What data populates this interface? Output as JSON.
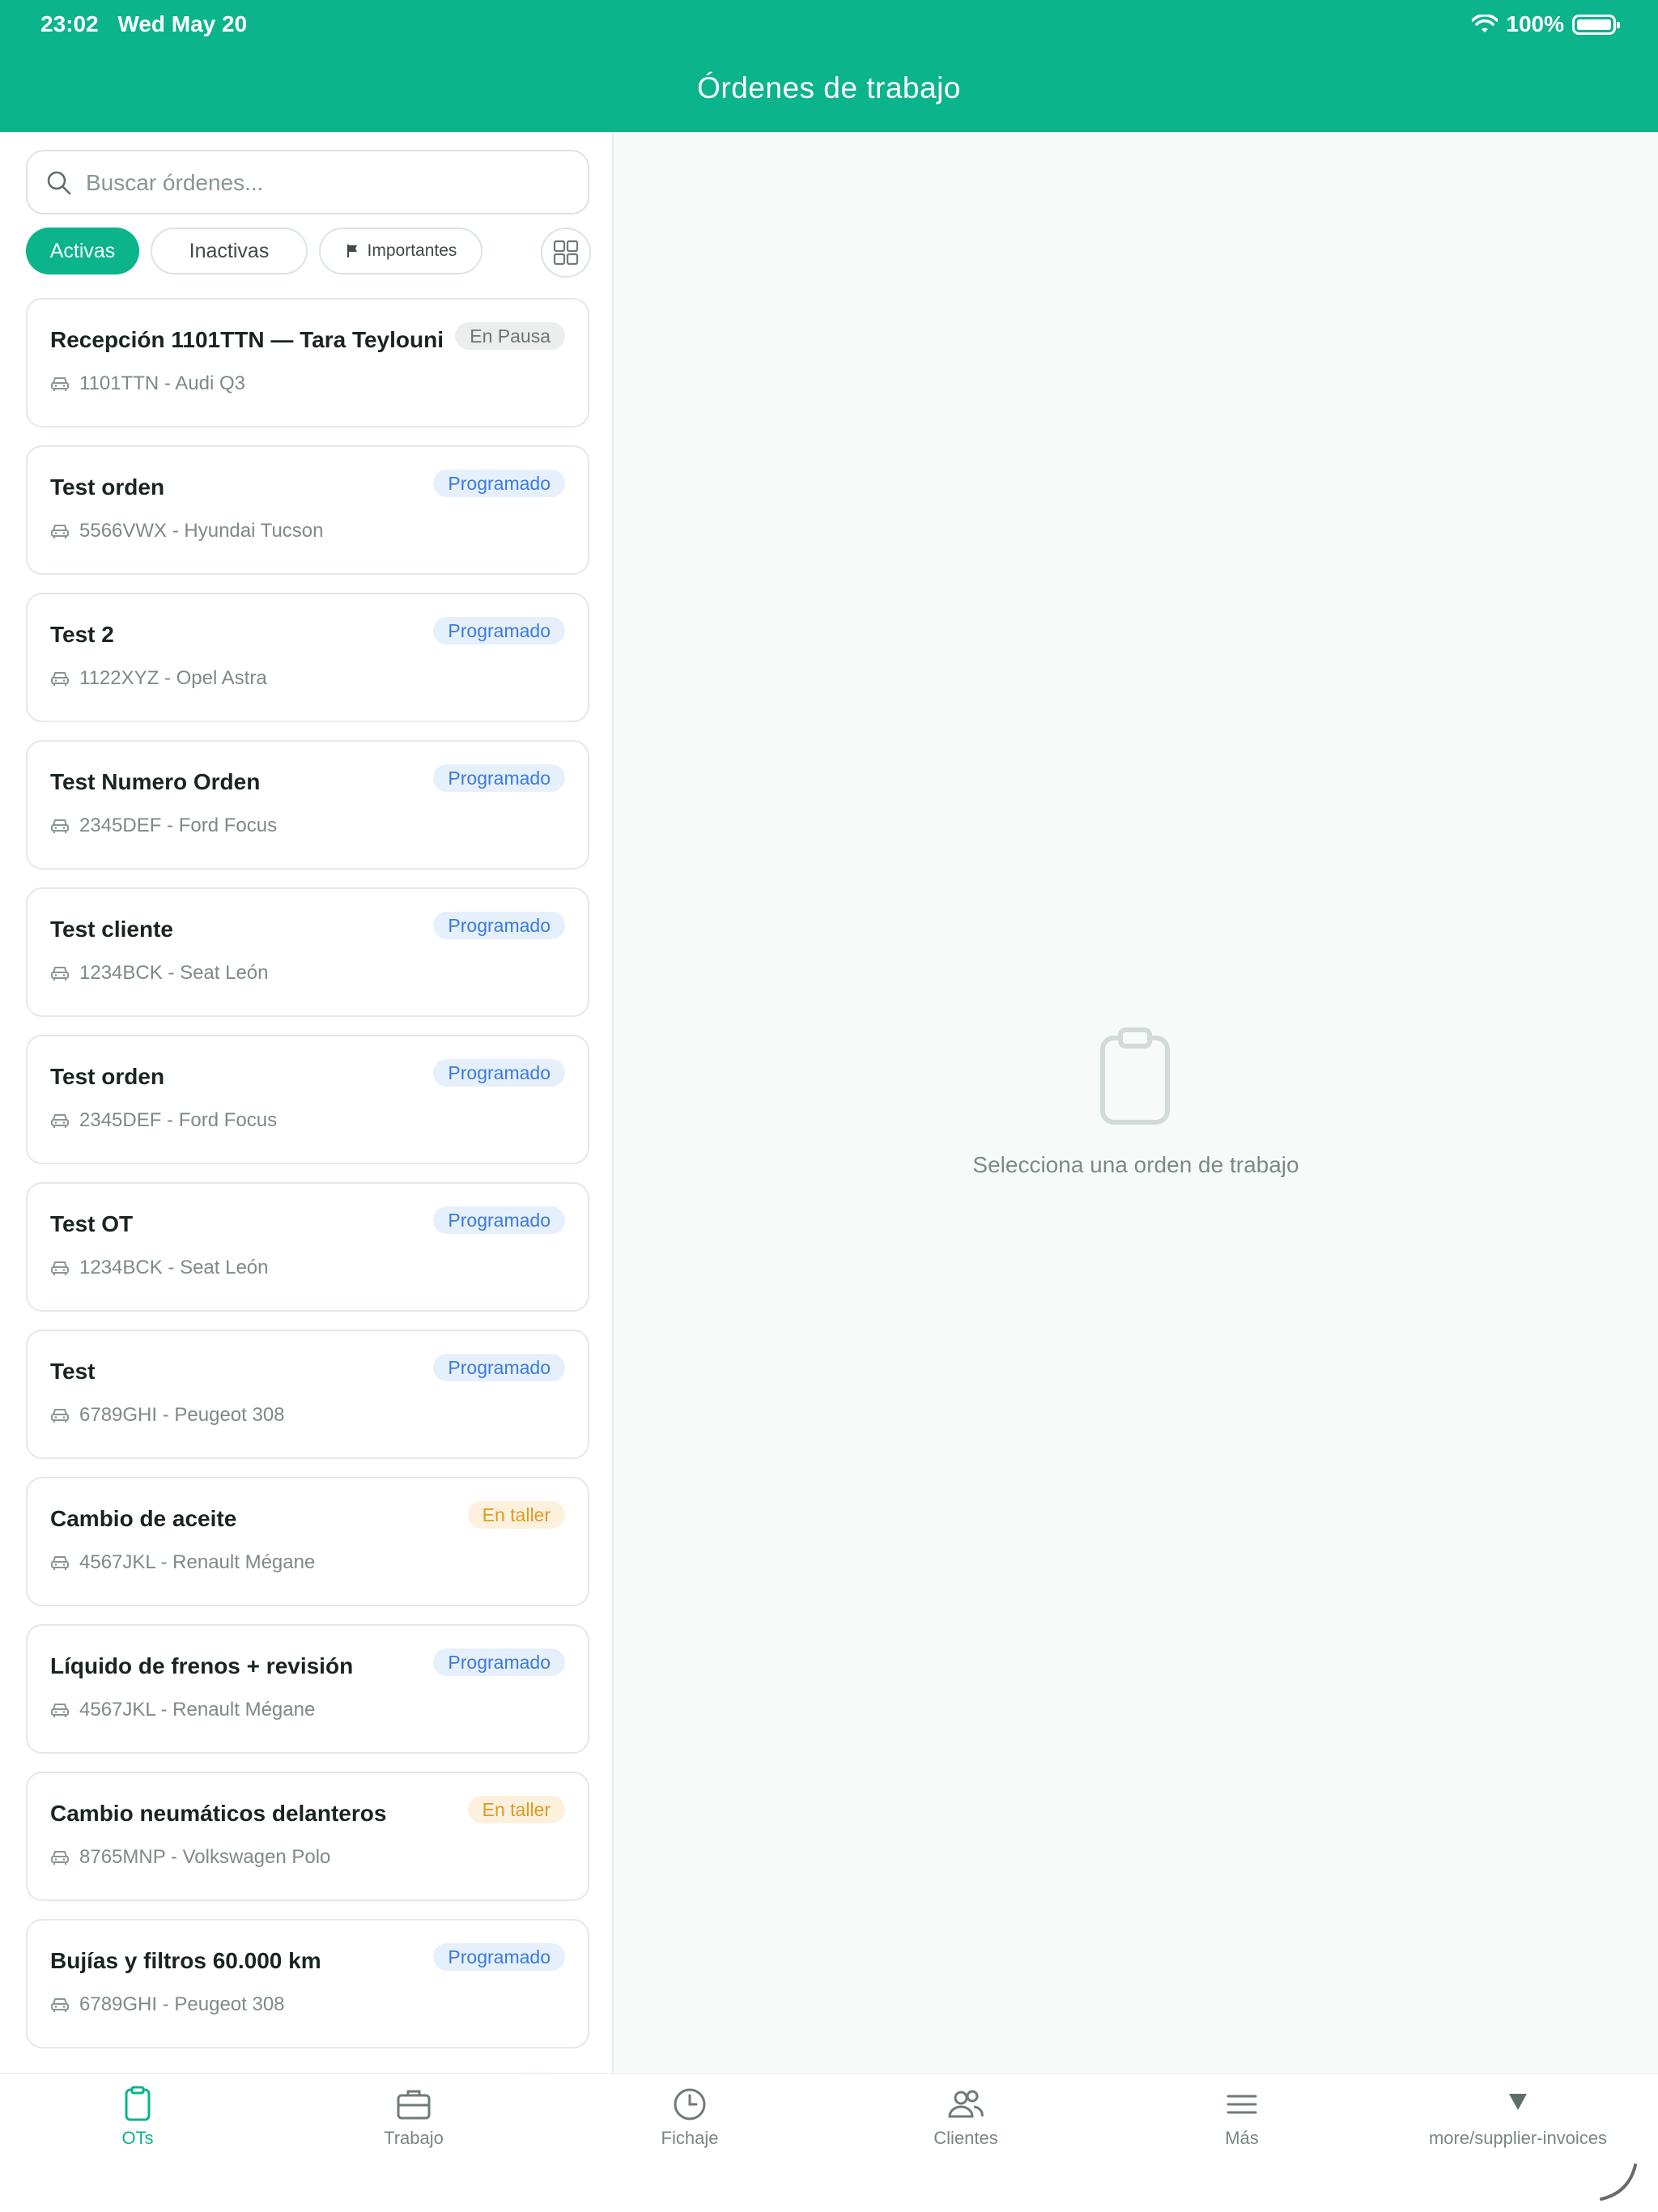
{
  "status_bar": {
    "time": "23:02",
    "date": "Wed May 20",
    "battery": "100%",
    "icons": [
      "wifi-icon",
      "battery-icon"
    ]
  },
  "header": {
    "title": "Órdenes de trabajo"
  },
  "search": {
    "placeholder": "Buscar órdenes...",
    "value": ""
  },
  "filters": {
    "active_label": "Activas",
    "inactive_label": "Inactivas",
    "important_label": "Importantes"
  },
  "orders": [
    {
      "title": "Recepción 1101TTN — Tara Teylouni",
      "status": "En Pausa",
      "vehicle": "1101TTN - Audi Q3"
    },
    {
      "title": "Test orden",
      "status": "Programado",
      "vehicle": "5566VWX - Hyundai Tucson"
    },
    {
      "title": "Test 2",
      "status": "Programado",
      "vehicle": "1122XYZ - Opel Astra"
    },
    {
      "title": "Test Numero Orden",
      "status": "Programado",
      "vehicle": "2345DEF - Ford Focus"
    },
    {
      "title": "Test cliente",
      "status": "Programado",
      "vehicle": "1234BCK - Seat León"
    },
    {
      "title": "Test orden",
      "status": "Programado",
      "vehicle": "2345DEF - Ford Focus"
    },
    {
      "title": "Test OT",
      "status": "Programado",
      "vehicle": "1234BCK - Seat León"
    },
    {
      "title": "Test",
      "status": "Programado",
      "vehicle": "6789GHI - Peugeot 308"
    },
    {
      "title": "Cambio de aceite",
      "status": "En taller",
      "vehicle": "4567JKL - Renault Mégane"
    },
    {
      "title": "Líquido de frenos + revisión",
      "status": "Programado",
      "vehicle": "4567JKL - Renault Mégane"
    },
    {
      "title": "Cambio neumáticos delanteros",
      "status": "En taller",
      "vehicle": "8765MNP - Volkswagen Polo"
    },
    {
      "title": "Bujías y filtros 60.000 km",
      "status": "Programado",
      "vehicle": "6789GHI - Peugeot 308"
    }
  ],
  "detail": {
    "empty_text": "Selecciona una orden de trabajo"
  },
  "tabs": [
    {
      "label": "OTs",
      "icon": "clipboard-icon"
    },
    {
      "label": "Trabajo",
      "icon": "briefcase-icon"
    },
    {
      "label": "Fichaje",
      "icon": "clock-icon"
    },
    {
      "label": "Clientes",
      "icon": "users-icon"
    },
    {
      "label": "Más",
      "icon": "menu-icon"
    },
    {
      "label": "more/supplier-invoices",
      "icon": "triangle-down-icon"
    }
  ],
  "colors": {
    "brand": "#0bb48b",
    "scheduled_badge": "#3a7be0",
    "paused_badge": "#6b7470",
    "workshop_badge": "#e09a1f"
  }
}
